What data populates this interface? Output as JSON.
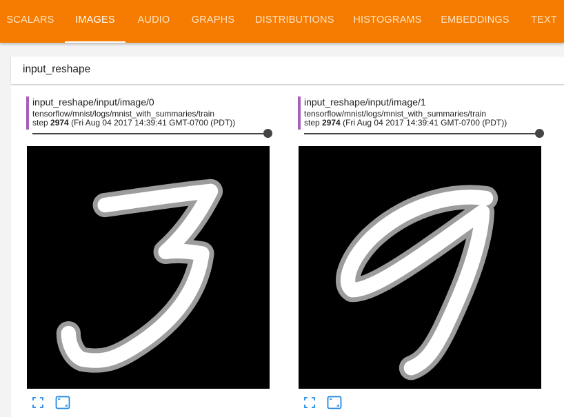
{
  "nav": {
    "tabs": [
      {
        "label": "SCALARS",
        "active": false
      },
      {
        "label": "IMAGES",
        "active": true
      },
      {
        "label": "AUDIO",
        "active": false
      },
      {
        "label": "GRAPHS",
        "active": false
      },
      {
        "label": "DISTRIBUTIONS",
        "active": false
      },
      {
        "label": "HISTOGRAMS",
        "active": false
      },
      {
        "label": "EMBEDDINGS",
        "active": false
      },
      {
        "label": "TEXT",
        "active": false
      }
    ],
    "bar_color": "#f57c00"
  },
  "group": {
    "title": "input_reshape"
  },
  "cards": [
    {
      "title": "input_reshape/input/image/0",
      "run": "tensorflow/mnist/logs/mnist_with_summaries/train",
      "step_label": "step",
      "step": "2974",
      "timestamp": "(Fri Aug 04 2017 14:39:41 GMT-0700 (PDT))",
      "slider_fraction": 1.0,
      "digit_image": "handwritten-digit-3",
      "accent_color": "#a65fbf"
    },
    {
      "title": "input_reshape/input/image/1",
      "run": "tensorflow/mnist/logs/mnist_with_summaries/train",
      "step_label": "step",
      "step": "2974",
      "timestamp": "(Fri Aug 04 2017 14:39:41 GMT-0700 (PDT))",
      "slider_fraction": 1.0,
      "digit_image": "handwritten-digit-9",
      "accent_color": "#a65fbf"
    }
  ],
  "icons": {
    "fullscreen": "fullscreen-icon",
    "actual_size": "actual-size-icon",
    "color": "#1e88e5"
  }
}
